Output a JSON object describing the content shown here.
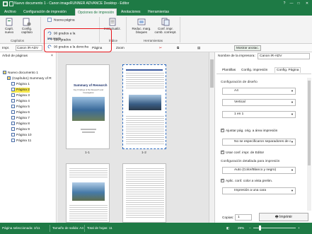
{
  "window": {
    "title": "Nuevo documento 1 - Canon imageRUNNER ADVANCE Desktop - Editor",
    "controls": [
      "?",
      "—",
      "□",
      "✕"
    ]
  },
  "ribbon_tabs": [
    "Archivo",
    "Configuración de impresión",
    "Opciones de impresión",
    "Anotaciones",
    "Herramientas"
  ],
  "active_tab_index": 2,
  "ribbon": {
    "capitulo_nuevo": "Capít. nuevo",
    "config_capitulo": "Config. capítulo",
    "group_capitulos": "Capítulos",
    "nueva_pagina": "Nueva página",
    "rotate_left": "90 grados a la izquierda",
    "rotate_180": "180 grados",
    "rotate_right": "90 grados a la derecha",
    "insertar": "Ins/actualiz.",
    "group_indice": "Índice",
    "reduc_marg": "Reduc. marg. bloques",
    "conf_impr": "Conf. impr. comb. correspt.",
    "group_herramientas": "Herramientas"
  },
  "toolbar2": {
    "printer_label": "Impr.",
    "printer_value": "Canon iR-ADV",
    "page_label": "Página",
    "zoom_label": "Zoom",
    "mostrar_anotac": "Mostrar anotac."
  },
  "left_pane": {
    "header": "Árbol de páginas",
    "items": [
      {
        "label": "Nuevo documento 1",
        "level": 0
      },
      {
        "label": "(Capítulo1) Summary of R",
        "level": 1
      },
      {
        "label": "Página 1",
        "level": 2
      },
      {
        "label": "Página 2",
        "level": 2,
        "selected": true
      },
      {
        "label": "Página 3",
        "level": 2
      },
      {
        "label": "Página 4",
        "level": 2
      },
      {
        "label": "Página 5",
        "level": 2
      },
      {
        "label": "Página 6",
        "level": 2
      },
      {
        "label": "Página 7",
        "level": 2
      },
      {
        "label": "Página 8",
        "level": 2
      },
      {
        "label": "Página 9",
        "level": 2
      },
      {
        "label": "Página 10",
        "level": 2
      },
      {
        "label": "Página 11",
        "level": 2
      }
    ]
  },
  "center": {
    "page1_label": "1-1",
    "page2_label": "1-2",
    "doc_title": "Summary of Research",
    "doc_subtitle": "Key Findings of the Research and Investigation"
  },
  "right_pane": {
    "printer_label": "Nombre de la impresora:",
    "printer_value": "Canon iR-ADV",
    "tabs": [
      "Plantillas",
      "Config. impresión",
      "Config. Página"
    ],
    "active_tab_index": 2,
    "layout_section": "Configuración de diseño",
    "paper_size": "A4",
    "orientation": "Vertical",
    "pages_per_sheet": "1 en 1",
    "fit_check": "Ajustar pág. orig. a área impresión",
    "separator": "No se especificaron separadores de c",
    "use_editor_conf": "Usar conf. impr. de Editor",
    "detail_section": "Configuración detallada para impresión",
    "color_mode": "Auto (Color/Blanco y negro)",
    "apply_color": "Aplic. conf. color a vista prelim.",
    "print_side": "Impresión a una cara",
    "copies_label": "Copias:",
    "copies_value": "1",
    "print_button": "Imprimir"
  },
  "status": {
    "selected_page": "Página seleccionada: 2/11",
    "output_size": "Tamaño de salida: A4",
    "total_sheets": "Total de hojas: 11",
    "zoom": "29%"
  },
  "colors": {
    "accent": "#1e7a45",
    "highlight_box": "#e8141a",
    "selection": "#f6e74a"
  }
}
